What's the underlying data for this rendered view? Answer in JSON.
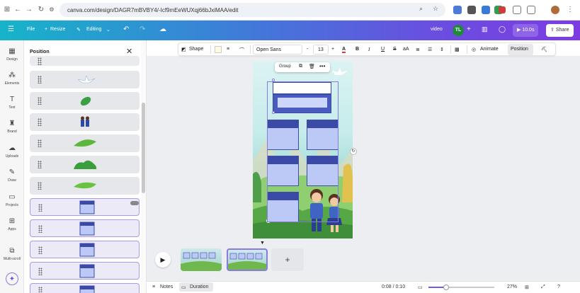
{
  "browser": {
    "url": "canva.com/design/DAGR7mBVBY4/-Icf9mEeWUXqj66bJxiMAA/edit"
  },
  "header": {
    "file": "File",
    "resize": "Resize",
    "editing": "Editing",
    "video_label": "video",
    "avatar_initials": "TL",
    "play_time": "10.0s",
    "share": "Share"
  },
  "rail": {
    "items": [
      "Design",
      "Elements",
      "Text",
      "Brand",
      "Uploads",
      "Draw",
      "Projects",
      "Apps",
      "Multi-scroll"
    ]
  },
  "panel": {
    "title": "Position"
  },
  "toolbar": {
    "shape": "Shape",
    "font": "Open Sans",
    "minus": "-",
    "size": "13",
    "plus": "+",
    "bold": "B",
    "italic": "I",
    "underline": "U",
    "strike": "S",
    "case": "aA",
    "animate": "Animate",
    "position": "Position"
  },
  "canvas": {
    "group_label": "Group"
  },
  "footer": {
    "notes": "Notes",
    "duration": "Duration",
    "time": "0:08 / 0:10",
    "zoom": "27%",
    "zoom_fraction": 0.27
  },
  "colors": {
    "header_start": "#16b4c9",
    "header_end": "#7d3ce2",
    "card_fill": "#bcc8f5",
    "card_top": "#3a4aa6",
    "selection": "#a99be8"
  }
}
